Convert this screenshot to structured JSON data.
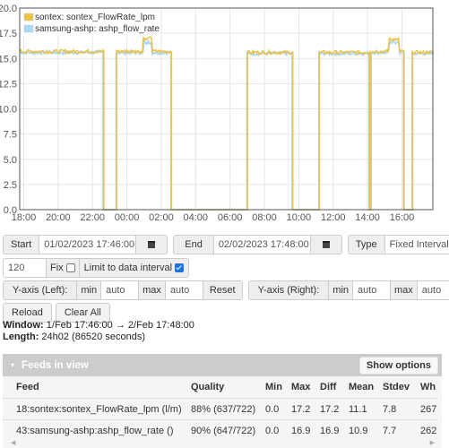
{
  "chart_data": {
    "type": "line",
    "title": "",
    "xlabel": "",
    "ylabel": "",
    "ylim": [
      0,
      20
    ],
    "y_ticks": [
      "0.0",
      "2.5",
      "5.0",
      "7.5",
      "10.0",
      "12.5",
      "15.0",
      "17.5",
      "20.0"
    ],
    "x_range_hours": [
      -0.2333,
      23.8
    ],
    "x_ticks": [
      {
        "h": 0,
        "label": "18:00"
      },
      {
        "h": 2,
        "label": "20:00"
      },
      {
        "h": 4,
        "label": "22:00"
      },
      {
        "h": 6,
        "label": "00:00"
      },
      {
        "h": 8,
        "label": "02:00"
      },
      {
        "h": 10,
        "label": "04:00"
      },
      {
        "h": 12,
        "label": "06:00"
      },
      {
        "h": 14,
        "label": "08:00"
      },
      {
        "h": 16,
        "label": "10:00"
      },
      {
        "h": 18,
        "label": "12:00"
      },
      {
        "h": 20,
        "label": "14:00"
      },
      {
        "h": 22,
        "label": "16:00"
      }
    ],
    "grid": true,
    "legend_position": "top-left",
    "series": [
      {
        "name": "sontex: sontex_FlowRate_lpm",
        "color": "#edc240",
        "segments_hours_from_18": [
          {
            "on": [
              -0.2333,
              4.66
            ],
            "level": 15.7
          },
          {
            "on": [
              5.4,
              8.6
            ],
            "level": 15.7,
            "bump": [
              [
                6.9,
                7.45
              ],
              17.0
            ]
          },
          {
            "on": [
              13.02,
              15.65
            ],
            "level": 15.6
          },
          {
            "on": [
              17.2,
              20.12
            ],
            "level": 15.6
          },
          {
            "on": [
              20.18,
              22.1
            ],
            "level": 15.7,
            "bump": [
              [
                21.2,
                21.85
              ],
              16.9
            ]
          },
          {
            "on": [
              22.6,
              23.8
            ],
            "level": 15.6
          }
        ]
      },
      {
        "name": "samsung-ashp: ashp_flow_rate",
        "color": "#afd8f8",
        "segments_hours_from_18": [
          {
            "on": [
              -0.2333,
              4.62
            ],
            "level": 15.6
          },
          {
            "on": [
              5.38,
              8.57
            ],
            "level": 15.6,
            "bump": [
              [
                6.95,
                7.45
              ],
              16.6
            ]
          },
          {
            "on": [
              13.0,
              15.62
            ],
            "level": 15.5
          },
          {
            "on": [
              17.18,
              20.1
            ],
            "level": 15.5
          },
          {
            "on": [
              20.2,
              22.12
            ],
            "level": 15.6,
            "bump": [
              [
                21.25,
                21.85
              ],
              16.6
            ]
          },
          {
            "on": [
              22.62,
              23.8
            ],
            "level": 15.5
          }
        ]
      }
    ]
  },
  "controls": {
    "start_label": "Start",
    "start_value": "01/02/2023 17:46:00",
    "end_label": "End",
    "end_value": "02/02/2023 17:48:00",
    "type_label": "Type",
    "type_value": "Fixed Interval",
    "interval_value": "120",
    "fix_label": "Fix",
    "fix_checked": false,
    "limit_label": "Limit to data interval",
    "limit_checked": true,
    "yaxis_left_label": "Y-axis (Left):",
    "yaxis_right_label": "Y-axis (Right):",
    "min_label": "min",
    "max_label": "max",
    "left_min": "auto",
    "left_max": "auto",
    "right_min": "auto",
    "right_max": "auto",
    "reset_label": "Reset",
    "reload_label": "Reload",
    "clear_all_label": "Clear All"
  },
  "info": {
    "window_label": "Window:",
    "window_value": "1/Feb 17:46:00 → 2/Feb 17:48:00",
    "length_label": "Length:",
    "length_value": "24h02 (86520 seconds)"
  },
  "feeds": {
    "title": "Feeds in view",
    "show_options_label": "Show options",
    "columns": [
      "Feed",
      "Quality",
      "Min",
      "Max",
      "Diff",
      "Mean",
      "Stdev",
      "Wh"
    ],
    "rows": [
      [
        "18:sontex:sontex_FlowRate_lpm (l/m)",
        "88% (637/722)",
        "0.0",
        "17.2",
        "17.2",
        "11.1",
        "7.8",
        "267"
      ],
      [
        "43:samsung-ashp:ashp_flow_rate ()",
        "90% (647/722)",
        "0.0",
        "16.9",
        "16.9",
        "10.9",
        "7.7",
        "262"
      ]
    ]
  }
}
